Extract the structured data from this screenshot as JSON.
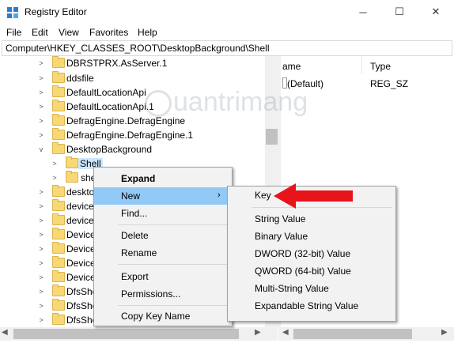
{
  "window": {
    "title": "Registry Editor",
    "minimize": "─",
    "maximize": "☐",
    "close": "✕"
  },
  "menu": [
    "File",
    "Edit",
    "View",
    "Favorites",
    "Help"
  ],
  "address": "Computer\\HKEY_CLASSES_ROOT\\DesktopBackground\\Shell",
  "tree": [
    {
      "label": "DBRSTPRX.AsServer.1",
      "expanded": false
    },
    {
      "label": "ddsfile",
      "expanded": false
    },
    {
      "label": "DefaultLocationApi",
      "expanded": false
    },
    {
      "label": "DefaultLocationApi.1",
      "expanded": false
    },
    {
      "label": "DefragEngine.DefragEngine",
      "expanded": false
    },
    {
      "label": "DefragEngine.DefragEngine.1",
      "expanded": false
    },
    {
      "label": "DesktopBackground",
      "expanded": true
    },
    {
      "label": "Shell",
      "expanded": false,
      "selected": true
    },
    {
      "label": "she",
      "expanded": false
    },
    {
      "label": "deskto",
      "expanded": false
    },
    {
      "label": "device",
      "expanded": false
    },
    {
      "label": "device",
      "expanded": false
    },
    {
      "label": "Device",
      "expanded": false
    },
    {
      "label": "Device",
      "expanded": false
    },
    {
      "label": "Device",
      "expanded": false
    },
    {
      "label": "Device",
      "expanded": false
    },
    {
      "label": "DfsShe",
      "expanded": false
    },
    {
      "label": "DfsShe",
      "expanded": false
    },
    {
      "label": "DfsShe",
      "expanded": false
    }
  ],
  "values_pane": {
    "col_name": "ame",
    "col_type": "Type",
    "rows": [
      {
        "name": "(Default)",
        "type": "REG_SZ"
      }
    ]
  },
  "context_menu": {
    "items": [
      "Expand",
      "New",
      "Find...",
      "Delete",
      "Rename",
      "Export",
      "Permissions...",
      "Copy Key Name"
    ]
  },
  "submenu": {
    "items": [
      "Key",
      "String Value",
      "Binary Value",
      "DWORD (32-bit) Value",
      "QWORD (64-bit) Value",
      "Multi-String Value",
      "Expandable String Value"
    ]
  },
  "watermark": "uantrimang",
  "colors": {
    "arrow": "#e8141b",
    "folder": "#f8d775",
    "selection": "#cce8ff",
    "menu_highlight": "#91c9f7"
  }
}
